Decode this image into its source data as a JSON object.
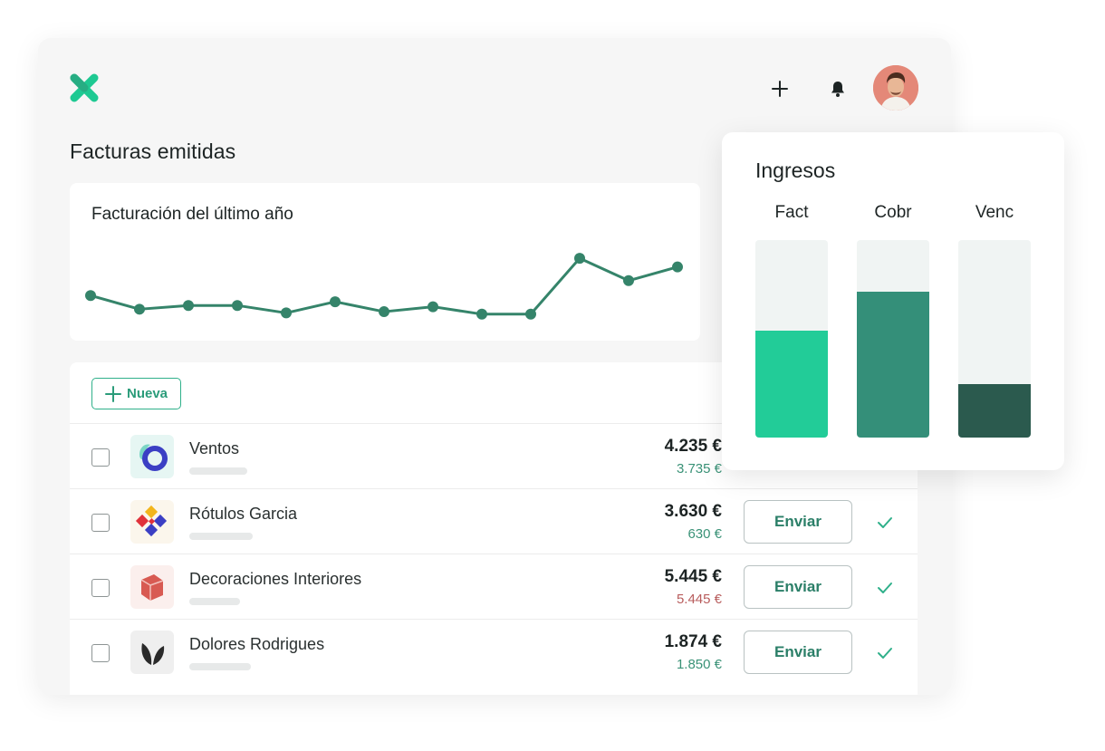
{
  "header": {
    "logo_icon": "x-logo-icon",
    "add_icon": "plus-icon",
    "notifications_icon": "bell-icon",
    "avatar_icon": "user-avatar"
  },
  "page": {
    "title": "Facturas emitidas"
  },
  "billing_chart": {
    "title": "Facturación del último año",
    "line_color": "#35846a",
    "chart_data": {
      "type": "line",
      "x": [
        1,
        2,
        3,
        4,
        5,
        6,
        7,
        8,
        9,
        10,
        11,
        12,
        13
      ],
      "values": [
        29,
        18,
        21,
        21,
        15,
        24,
        16,
        20,
        14,
        14,
        59,
        41,
        52
      ],
      "ylim": [
        0,
        70
      ],
      "grid": false
    }
  },
  "list": {
    "new_button_label": "Nueva",
    "send_label": "Enviar",
    "rows": [
      {
        "name": "Ventos",
        "total": "4.235 €",
        "sub": "3.735 €",
        "status": "pending"
      },
      {
        "name": "Rótulos Garcia",
        "total": "3.630 €",
        "sub": "630 €",
        "status": "pending"
      },
      {
        "name": "Decoraciones Interiores",
        "total": "5.445 €",
        "sub": "5.445 €",
        "status": "overdue"
      },
      {
        "name": "Dolores Rodrigues",
        "total": "1.874 €",
        "sub": "1.850 €",
        "status": "pending"
      }
    ]
  },
  "income": {
    "title": "Ingresos",
    "chart_data": {
      "type": "bar",
      "categories": [
        "Fact",
        "Cobr",
        "Venc"
      ],
      "values": [
        0.54,
        0.74,
        0.27
      ],
      "ylim": [
        0,
        1
      ],
      "colors": [
        "#22cc98",
        "#348f79",
        "#2b5a4e"
      ],
      "track_color": "#f0f4f3"
    }
  }
}
